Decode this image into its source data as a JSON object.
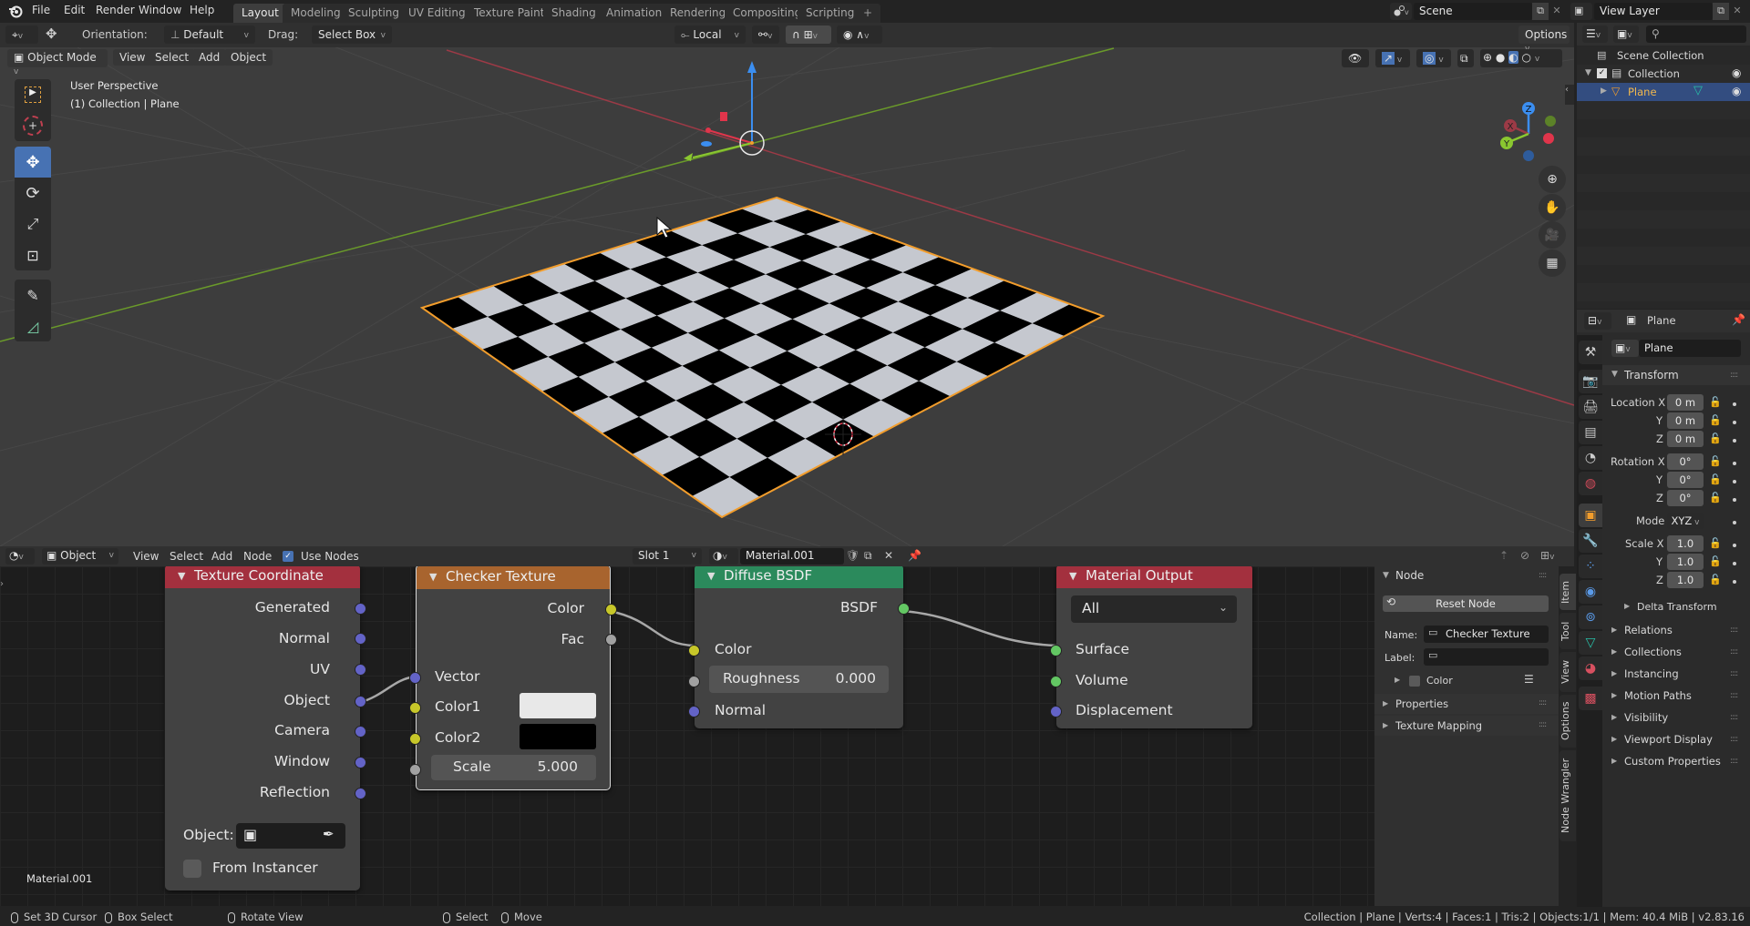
{
  "app": {
    "name": "Blender",
    "version": "v2.83.16"
  },
  "topbar": {
    "menus": [
      "File",
      "Edit",
      "Render",
      "Window",
      "Help"
    ],
    "workspaces": [
      "Layout",
      "Modeling",
      "Sculpting",
      "UV Editing",
      "Texture Paint",
      "Shading",
      "Animation",
      "Rendering",
      "Compositing",
      "Scripting"
    ],
    "active_workspace": "Layout",
    "add_workspace": "+",
    "scene": "Scene",
    "view_layer": "View Layer"
  },
  "viewport_header": {
    "orientation_label": "Orientation:",
    "orientation_value": "Default",
    "drag_label": "Drag:",
    "drag_value": "Select Box",
    "pivot_value": "Local",
    "options_label": "Options",
    "mode": "Object Mode",
    "menus": [
      "View",
      "Select",
      "Add",
      "Object"
    ]
  },
  "viewport": {
    "overlay_line1": "User Perspective",
    "overlay_line2": "(1) Collection | Plane",
    "gizmo_axes": {
      "x": "X",
      "y": "Y",
      "z": "Z"
    },
    "tools": [
      "select-box",
      "cursor",
      "move",
      "rotate",
      "scale",
      "transform",
      "annotate",
      "measure"
    ],
    "active_tool": "move",
    "colors": {
      "x_axis": "#9c3a46",
      "y_axis": "#6a9a2a",
      "selection": "#f29d2c",
      "checker_light": "#c5c8cf",
      "checker_dark": "#000000"
    }
  },
  "outliner": {
    "root": "Scene Collection",
    "items": [
      {
        "name": "Collection",
        "checked": true,
        "visible": true
      },
      {
        "name": "Plane",
        "selected": true,
        "visible": true
      }
    ]
  },
  "properties": {
    "header_object": "Plane",
    "object_name": "Plane",
    "transform": {
      "title": "Transform",
      "location_label": "Location X",
      "location": [
        "0 m",
        "0 m",
        "0 m"
      ],
      "rotation_label": "Rotation X",
      "rotation": [
        "0°",
        "0°",
        "0°"
      ],
      "mode_label": "Mode",
      "mode": "XYZ",
      "scale_label": "Scale X",
      "scale": [
        "1.0",
        "1.0",
        "1.0"
      ],
      "y": "Y",
      "z": "Z"
    },
    "delta_transform": "Delta Transform",
    "sections": [
      "Relations",
      "Collections",
      "Instancing",
      "Motion Paths",
      "Visibility",
      "Viewport Display",
      "Custom Properties"
    ]
  },
  "node_editor": {
    "header": {
      "type": "Object",
      "menus": [
        "View",
        "Select",
        "Add",
        "Node"
      ],
      "use_nodes_label": "Use Nodes",
      "use_nodes": true,
      "slot": "Slot 1",
      "material": "Material.001"
    },
    "material_label": "Material.001",
    "nodes": {
      "texcoord": {
        "title": "Texture Coordinate",
        "outputs": [
          "Generated",
          "Normal",
          "UV",
          "Object",
          "Camera",
          "Window",
          "Reflection"
        ],
        "object_label": "Object:",
        "from_instancer": "From Instancer",
        "color": "#a3303e"
      },
      "checker": {
        "title": "Checker Texture",
        "outputs": [
          "Color",
          "Fac"
        ],
        "inputs": [
          "Vector",
          "Color1",
          "Color2"
        ],
        "scale_label": "Scale",
        "scale_value": "5.000",
        "color1": "#e8e8e8",
        "color2": "#000000",
        "color": "#a8642e"
      },
      "diffuse": {
        "title": "Diffuse BSDF",
        "output": "BSDF",
        "inputs": [
          "Color",
          "Normal"
        ],
        "roughness_label": "Roughness",
        "roughness_value": "0.000",
        "color": "#2b8a5c"
      },
      "output": {
        "title": "Material Output",
        "target": "All",
        "inputs": [
          "Surface",
          "Volume",
          "Displacement"
        ],
        "color": "#a3303e"
      }
    },
    "sidebar": {
      "panel": "Node",
      "reset": "Reset Node",
      "name_label": "Name:",
      "name_value": "Checker Texture",
      "label_label": "Label:",
      "label_value": "",
      "color_label": "Color",
      "sections": [
        "Properties",
        "Texture Mapping"
      ],
      "tabs": [
        "Item",
        "Tool",
        "View",
        "Options",
        "Node Wrangler"
      ]
    }
  },
  "statusbar": {
    "hints": [
      "Set 3D Cursor",
      "Box Select",
      "Rotate View",
      "Select",
      "Move"
    ],
    "stats": "Collection | Plane | Verts:4 | Faces:1 | Tris:2 | Objects:1/1 | Mem: 40.4 MiB | v2.83.16"
  }
}
